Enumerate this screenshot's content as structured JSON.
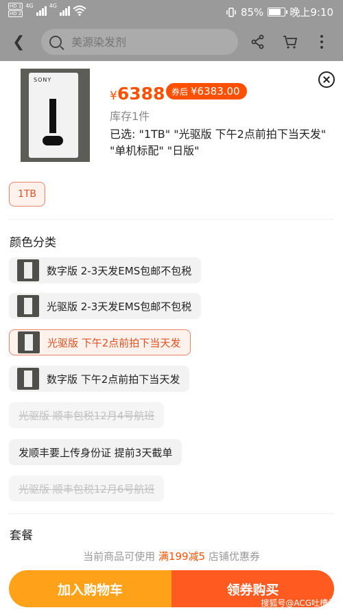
{
  "status": {
    "hd1": "HD 1",
    "hd2": "HD 2",
    "net1": "4G",
    "net2": "4G",
    "battery_pct": "85%",
    "battery_level": 0.85,
    "time": "晚上9:10"
  },
  "nav": {
    "search_placeholder": "美源染发剂"
  },
  "product": {
    "brand_on_box": "SONY",
    "price_symbol": "¥",
    "price": "6388",
    "coupon_label": "券后",
    "coupon_price": "¥6383.00",
    "stock": "库存1件",
    "selected_line1": "已选: \"1TB\" \"光驱版 下午2点前拍下当天发\"",
    "selected_line2": "\"单机标配\" \"日版\""
  },
  "capacity": {
    "option": "1TB"
  },
  "color": {
    "title": "颜色分类",
    "options": [
      "数字版 2-3天发EMS包邮不包税",
      "光驱版 2-3天发EMS包邮不包税",
      "光驱版 下午2点前拍下当天发",
      "数字版 下午2点前拍下当天发",
      "光驱版 顺丰包税12月4号航班",
      "发顺丰要上传身份证 提前3天截单",
      "光驱版 顺丰包税12月6号航班"
    ]
  },
  "package": {
    "title": "套餐"
  },
  "promo": {
    "prefix": "当前商品可使用",
    "highlight": "满199减5",
    "suffix": "店铺优惠券"
  },
  "actions": {
    "add_cart": "加入购物车",
    "get_coupon": "领券购买"
  },
  "watermark": "搜狐号@ACG吐槽君"
}
